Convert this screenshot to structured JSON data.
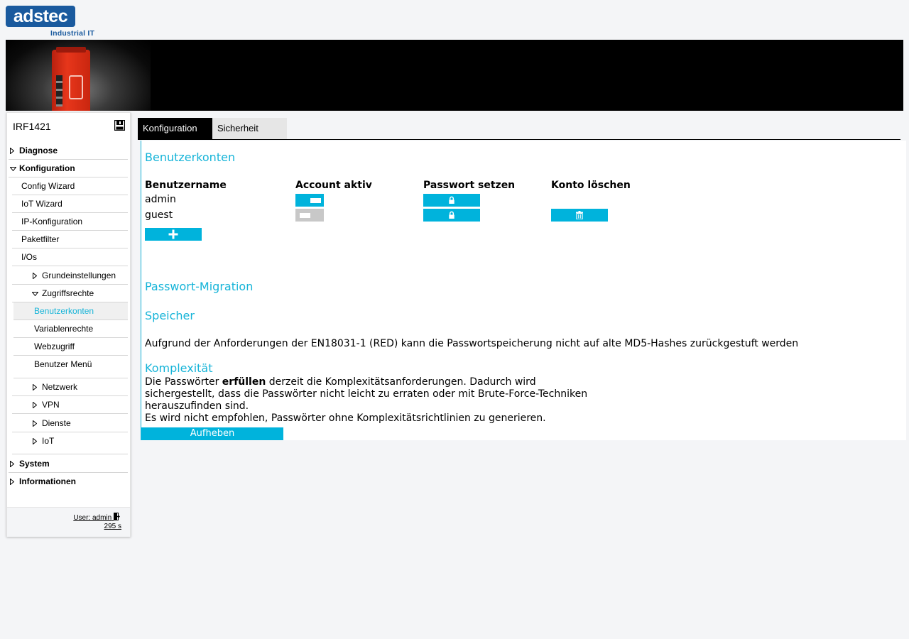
{
  "logo": {
    "brand": "adstec",
    "subtitle": "Industrial IT"
  },
  "sidebar": {
    "title": "IRF1421",
    "items": [
      {
        "label": "Diagnose"
      },
      {
        "label": "Konfiguration"
      },
      {
        "label": "Config Wizard"
      },
      {
        "label": "IoT Wizard"
      },
      {
        "label": "IP-Konfiguration"
      },
      {
        "label": "Paketfilter"
      },
      {
        "label": "I/Os"
      },
      {
        "label": "Grundeinstellungen"
      },
      {
        "label": "Zugriffsrechte"
      },
      {
        "label": "Benutzerkonten"
      },
      {
        "label": "Variablenrechte"
      },
      {
        "label": "Webzugriff"
      },
      {
        "label": "Benutzer Menü"
      },
      {
        "label": "Netzwerk"
      },
      {
        "label": "VPN"
      },
      {
        "label": "Dienste"
      },
      {
        "label": "IoT"
      },
      {
        "label": "System"
      },
      {
        "label": "Informationen"
      }
    ],
    "footer": {
      "user": "User: admin",
      "timer": "295 s"
    }
  },
  "tabs": [
    {
      "label": "Konfiguration"
    },
    {
      "label": "Sicherheit"
    }
  ],
  "accounts": {
    "heading": "Benutzerkonten",
    "columns": [
      "Benutzername",
      "Account aktiv",
      "Passwort setzen",
      "Konto löschen"
    ],
    "rows": [
      {
        "username": "admin",
        "active": true,
        "deletable": false
      },
      {
        "username": "guest",
        "active": false,
        "deletable": true
      }
    ]
  },
  "migration": {
    "heading": "Passwort-Migration",
    "storage_heading": "Speicher",
    "storage_text": "Aufgrund der Anforderungen der EN18031-1 (RED) kann die Passwortspeicherung nicht auf alte MD5-Hashes zurückgestuft werden",
    "complexity_heading": "Komplexität",
    "complexity_pre": "Die Passwörter ",
    "complexity_bold": "erfüllen",
    "complexity_post": " derzeit die Komplexitätsanforderungen. Dadurch wird",
    "complexity_line2": "sichergestellt, dass die Passwörter nicht leicht zu erraten oder mit Brute-Force-Techniken",
    "complexity_line3": "herauszufinden sind.",
    "complexity_line4": "Es wird nicht empfohlen, Passwörter ohne Komplexitätsrichtlinien zu generieren.",
    "release_button": "Aufheben"
  },
  "colors": {
    "accent": "#00b3dc",
    "brand": "#1a5a9e",
    "inactive_toggle": "#c8c8c8"
  }
}
